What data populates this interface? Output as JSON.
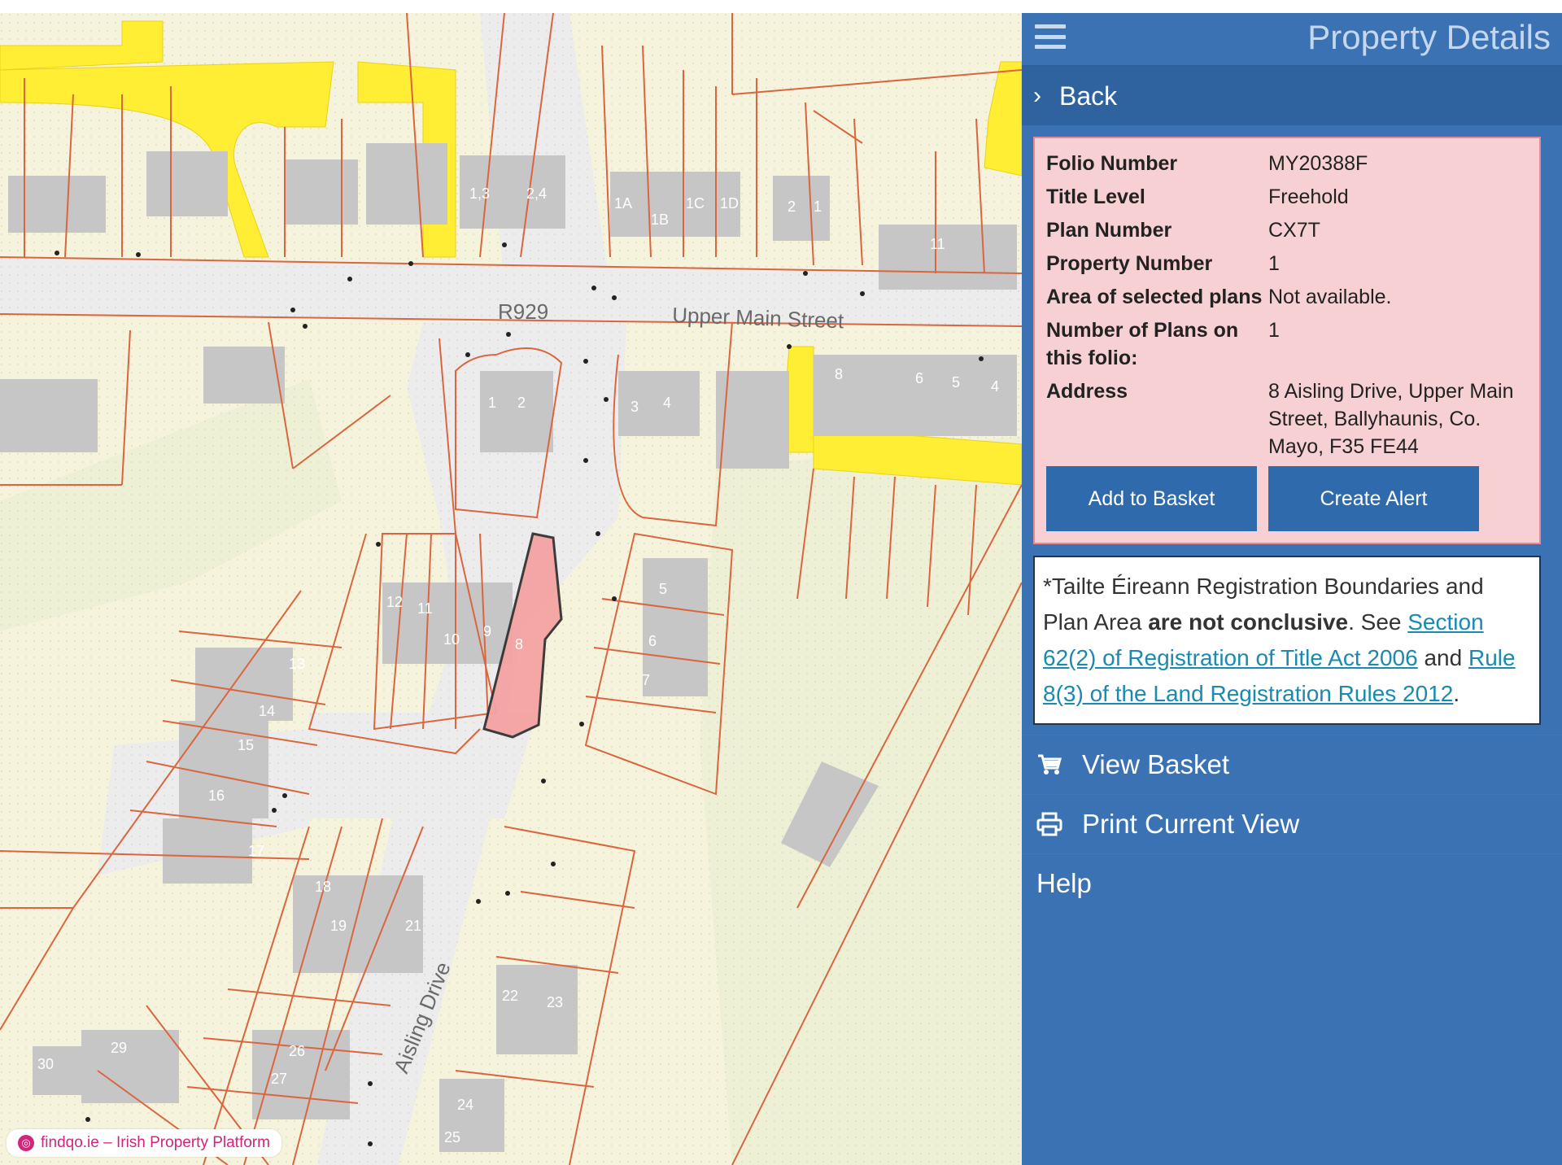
{
  "map": {
    "road_labels": {
      "r929": "R929",
      "upper_main_street": "Upper Main Street",
      "aisling_drive": "Aisling Drive"
    },
    "lot_numbers": [
      "1,3",
      "2,4",
      "1A",
      "1B",
      "1C",
      "1D",
      "2",
      "1",
      "11",
      "1",
      "2",
      "3",
      "4",
      "8",
      "6",
      "5",
      "4",
      "12",
      "11",
      "10",
      "9",
      "8",
      "5",
      "6",
      "7",
      "13",
      "14",
      "15",
      "16",
      "17",
      "18",
      "19",
      "21",
      "22",
      "23",
      "29",
      "26",
      "27",
      "30",
      "24",
      "25"
    ],
    "colors": {
      "background": "#f6f3dc",
      "boundary": "#d9663f",
      "road": "#ececec",
      "building": "#c6c6c6",
      "highlight_road": "#ffee33",
      "selected_plot": "#f5a3a3"
    }
  },
  "watermark": {
    "text": "findqo.ie – Irish Property Platform"
  },
  "panel": {
    "title": "Property Details",
    "back_label": "Back",
    "details": [
      {
        "label": "Folio Number",
        "value": "MY20388F"
      },
      {
        "label": "Title Level",
        "value": "Freehold"
      },
      {
        "label": "Plan Number",
        "value": "CX7T"
      },
      {
        "label": "Property Number",
        "value": "1"
      },
      {
        "label": "Area of selected plans",
        "value": "Not available."
      },
      {
        "label": "Number of Plans on this folio:",
        "value": "1"
      },
      {
        "label": "Address",
        "value": "8 Aisling Drive, Upper Main Street, Ballyhaunis, Co. Mayo, F35 FE44"
      }
    ],
    "buttons": {
      "add_to_basket": "Add to Basket",
      "create_alert": "Create Alert"
    },
    "disclaimer": {
      "text_1": "*Tailte Éireann Registration Boundaries and Plan Area ",
      "bold": "are not conclusive",
      "text_2": ". See ",
      "link_1": "Section 62(2) of Registration of Title Act 2006",
      "text_3": " and ",
      "link_2": "Rule 8(3) of the Land Registration Rules 2012",
      "text_4": "."
    },
    "menu": {
      "view_basket": "View Basket",
      "print_current_view": "Print Current View",
      "help": "Help"
    },
    "colors": {
      "panel_bg": "#3a72b3",
      "details_bg": "#f7d0d3",
      "button_bg": "#2f6aad"
    }
  }
}
